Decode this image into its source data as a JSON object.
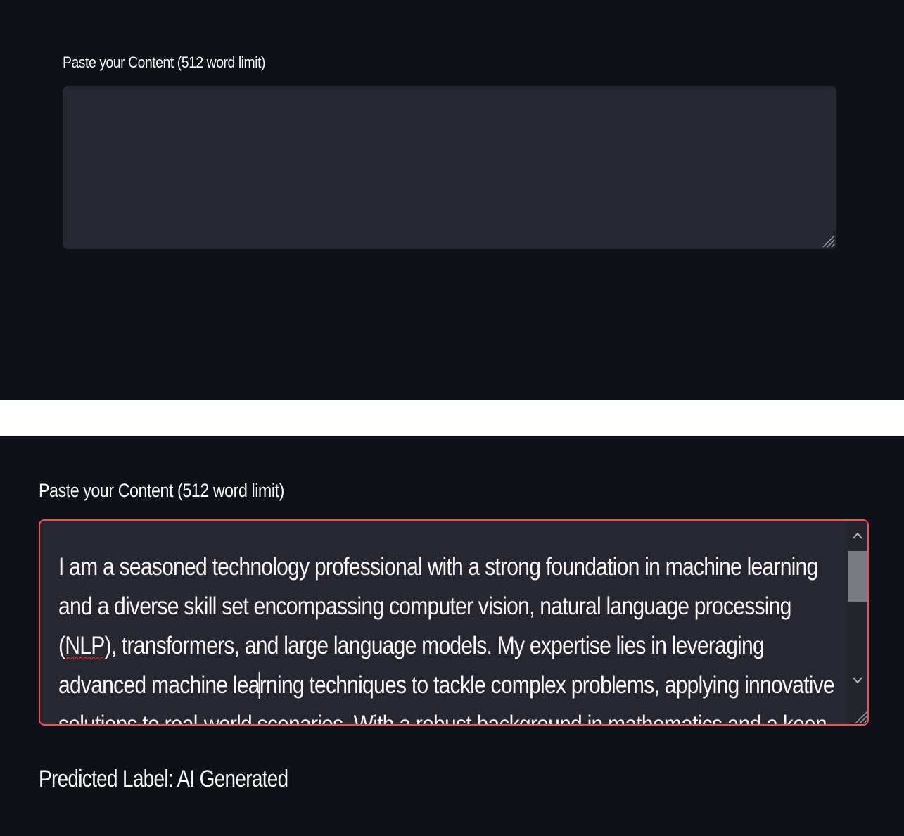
{
  "top_panel": {
    "label": "Paste your Content (512 word limit)",
    "textarea_value": ""
  },
  "bottom_panel": {
    "label": "Paste your Content (512 word limit)",
    "textarea": {
      "text_before_mis": "I am a seasoned technology professional with a strong foundation in machine learning and a diverse skill set encompassing computer vision, natural language processing (",
      "misspelled_word": "NLP",
      "text_after_mis_before_caret": "), transformers, and large language models. My expertise lies in leveraging advanced machine lea",
      "text_after_caret": "rning techniques to tackle complex problems, applying innovative solutions to real-world scenarios. With a robust background in mathematics and a keen problem-solving aptitude, I have successfully undertaken"
    },
    "prediction": "Predicted Label: AI Generated"
  },
  "colors": {
    "background": "#0e1118",
    "textarea_bg": "#262730",
    "focus_border": "#ff4b4b",
    "text": "#fafafa",
    "separator": "#ffffff"
  },
  "icons": {
    "resize": "resize-grip-icon",
    "scroll_up": "chevron-up-icon",
    "scroll_down": "chevron-down-icon"
  }
}
